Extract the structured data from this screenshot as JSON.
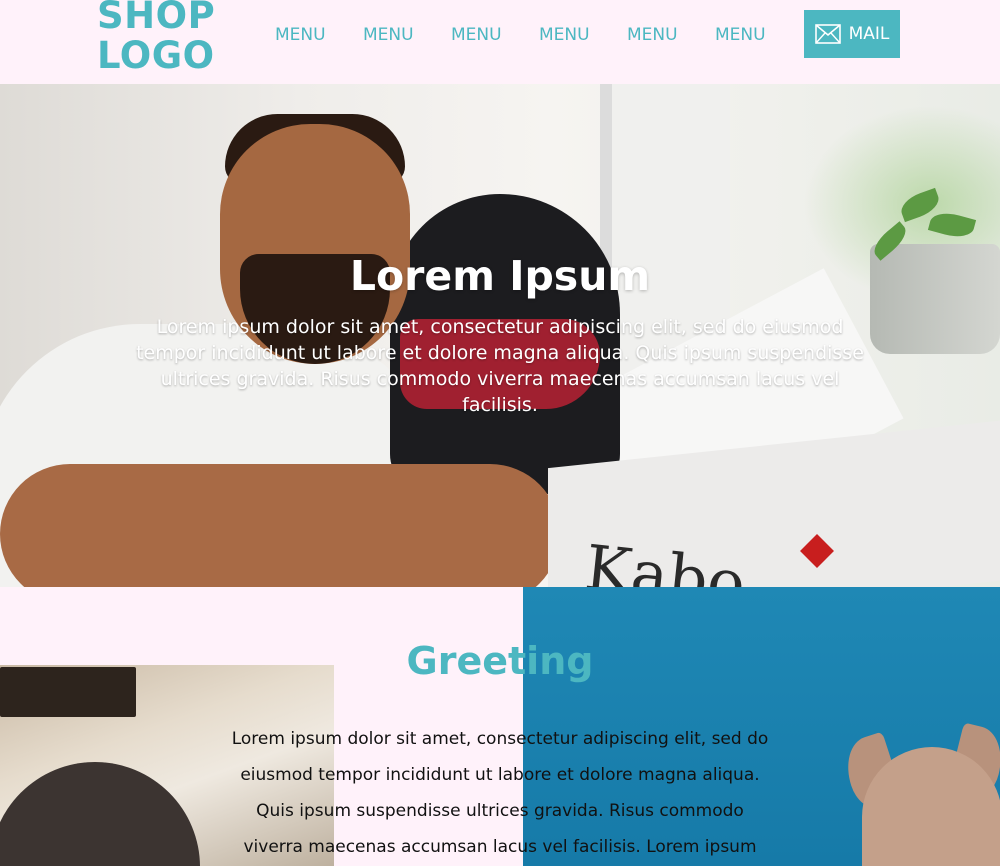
{
  "header": {
    "logo_line1": "SHOP",
    "logo_line2": "LOGO",
    "nav": [
      "MENU",
      "MENU",
      "MENU",
      "MENU",
      "MENU",
      "MENU"
    ],
    "mail_label": "MAIL"
  },
  "hero": {
    "title": "Lorem Ipsum",
    "text": "Lorem ipsum dolor sit amet, consectetur adipiscing elit, sed do eiusmod tempor incididunt ut labore et dolore magna aliqua. Quis ipsum suspendisse ultrices gravida. Risus commodo viverra maecenas accumsan lacus vel facilisis.",
    "box_brand": "Kabo"
  },
  "greeting": {
    "title": "Greeting",
    "text": "Lorem ipsum dolor sit amet, consectetur adipiscing elit, sed do eiusmod tempor incididunt ut labore et dolore magna aliqua. Quis ipsum suspendisse ultrices gravida. Risus commodo viverra maecenas accumsan lacus vel facilisis. Lorem ipsum dolor sit"
  },
  "colors": {
    "accent": "#4cb7c1",
    "header_bg": "#fff2fa",
    "photo_blue": "#1f88b5"
  },
  "icons": {
    "mail": "envelope-icon"
  }
}
